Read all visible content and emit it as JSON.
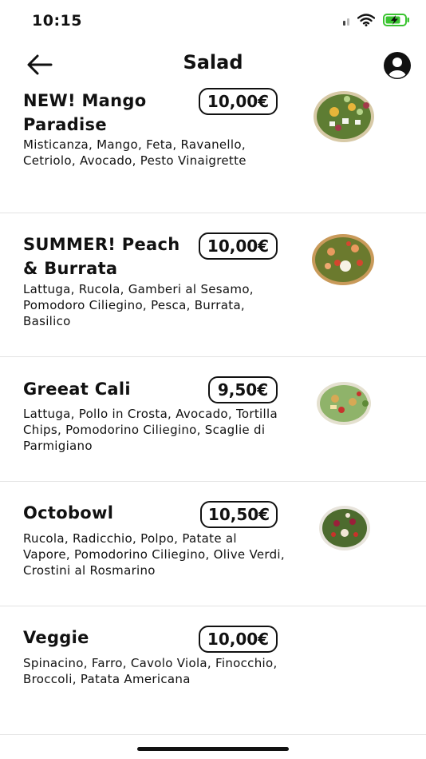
{
  "status_bar": {
    "time": "10:15",
    "icons": [
      "signal-icon",
      "wifi-icon",
      "battery-charging-icon"
    ]
  },
  "header": {
    "title": "Salad",
    "back_icon": "arrow-left-icon",
    "account_icon": "user-account-icon"
  },
  "items": [
    {
      "name": "NEW! Mango Paradise",
      "price": "10,00€",
      "ingredients": "Misticanza, Mango, Feta, Ravanello, Cetriolo, Avocado, Pesto Vinaigrette"
    },
    {
      "name": "SUMMER! Peach & Burrata",
      "price": "10,00€",
      "ingredients": "Lattuga, Rucola, Gamberi al Sesamo, Pomodoro Ciliegino, Pesca, Burrata, Basilico"
    },
    {
      "name": "Greeat Cali",
      "price": "9,50€",
      "ingredients": "Lattuga, Pollo in Crosta, Avocado, Tortilla Chips, Pomodorino Ciliegino,  Scaglie di Parmigiano"
    },
    {
      "name": "Octobowl",
      "price": "10,50€",
      "ingredients": "Rucola, Radicchio, Polpo, Patate al Vapore, Pomodorino Ciliegino, Olive Verdi, Crostini al Rosmarino"
    },
    {
      "name": "Veggie",
      "price": "10,00€",
      "ingredients": "Spinacino, Farro, Cavolo Viola, Finocchio, Broccoli, Patata Americana"
    }
  ],
  "colors": {
    "background": "#ffffff",
    "text": "#111111",
    "battery": "#3ac430",
    "divider": "#e3e3e3"
  }
}
